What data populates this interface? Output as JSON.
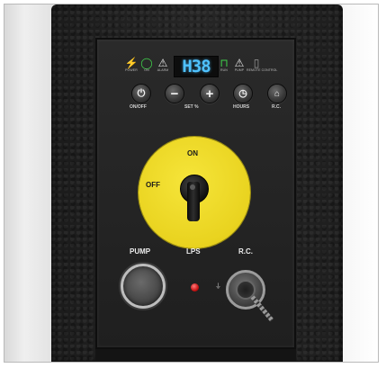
{
  "indicators": [
    {
      "id": "power",
      "glyph": "⚡",
      "label": "POWER",
      "color": "#f5a623"
    },
    {
      "id": "on",
      "glyph": "◯",
      "label": "ON",
      "color": "#3fd14a"
    },
    {
      "id": "alarm",
      "glyph": "⚠",
      "label": "ALARM",
      "color": "#e6e6e6"
    },
    {
      "id": "run",
      "glyph": "⊓",
      "label": "RUN",
      "color": "#3fd14a"
    },
    {
      "id": "pump",
      "glyph": "⚠",
      "label": "PUMP",
      "color": "#e6e6e6"
    },
    {
      "id": "remote",
      "glyph": "▯",
      "label": "REMOTE CONTROL",
      "color": "#9a9a9a"
    }
  ],
  "display": {
    "value": "H38",
    "color": "#4fc2ff"
  },
  "buttons": {
    "onoff": {
      "symbol": "⏻",
      "label": "ON/OFF"
    },
    "minus": {
      "symbol": "−"
    },
    "plus": {
      "symbol": "+"
    },
    "set_label": "SET %",
    "hours": {
      "symbol": "◷",
      "label": "HOURS"
    },
    "rc": {
      "symbol": "⌂",
      "label": "R.C."
    }
  },
  "main_switch": {
    "on_label": "ON",
    "off_label": "OFF",
    "color": "#ecd624"
  },
  "lower": {
    "pump_label": "PUMP",
    "lps_label": "LPS",
    "rc_label": "R.C.",
    "ground_symbol": "⏚"
  }
}
